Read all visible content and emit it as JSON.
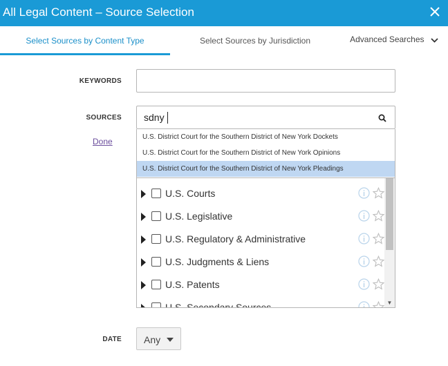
{
  "window": {
    "title": "All Legal Content – Source Selection",
    "close_icon": "close-icon"
  },
  "tabs": [
    {
      "label": "Select Sources by Content Type",
      "active": true
    },
    {
      "label": "Select Sources by Jurisdiction",
      "active": false
    },
    {
      "label": "Advanced Searches",
      "active": false
    }
  ],
  "keywords": {
    "label": "KEYWORDS",
    "value": ""
  },
  "sources": {
    "label": "SOURCES",
    "value": "sdny",
    "done_label": "Done",
    "suggestions": [
      "U.S. District Court for the Southern District of New York Dockets",
      "U.S. District Court for the Southern District of New York Opinions",
      "U.S. District Court for the Southern District of New York Pleadings"
    ],
    "highlighted_index": 2,
    "tree_items": [
      "U.S. Courts",
      "U.S. Legislative",
      "U.S. Regulatory & Administrative",
      "U.S. Judgments & Liens",
      "U.S. Patents",
      "U.S. Secondary Sources"
    ]
  },
  "date": {
    "label": "DATE",
    "value": "Any"
  },
  "colors": {
    "accent": "#1a9ad6",
    "highlight": "#bfd7f2",
    "link": "#6a4c9c"
  }
}
